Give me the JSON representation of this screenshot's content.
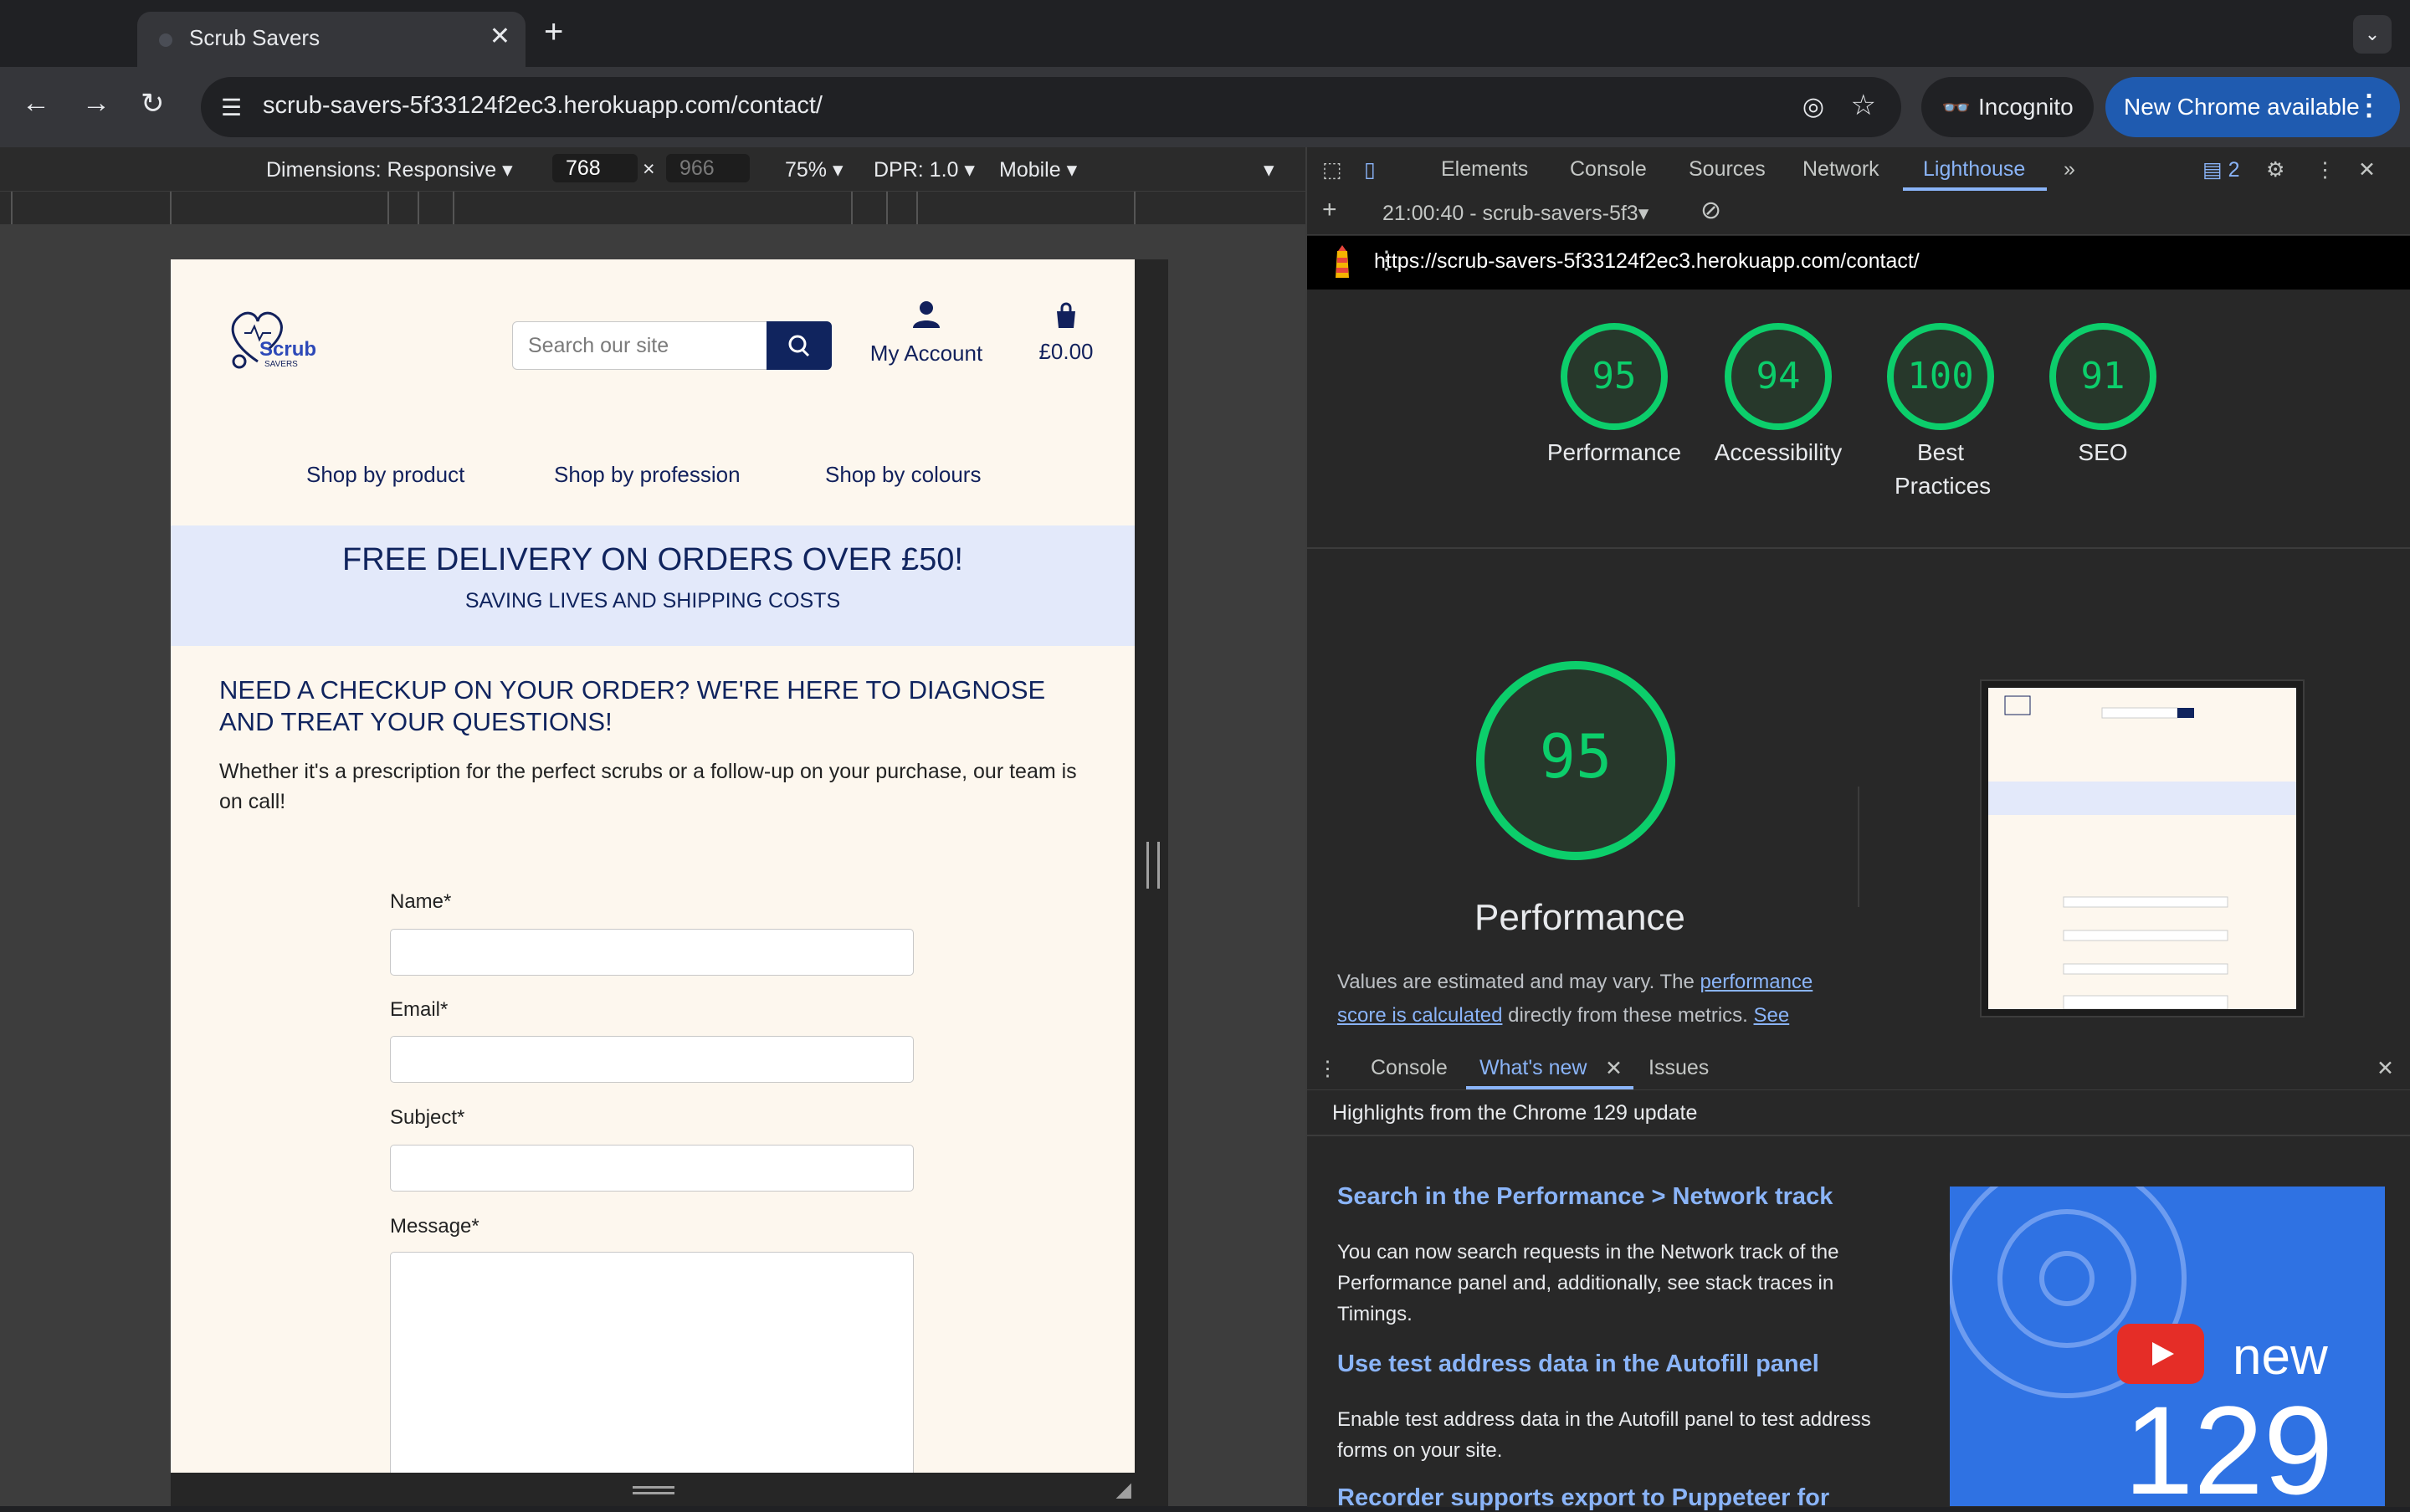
{
  "browser": {
    "tab_title": "Scrub Savers",
    "new_tab": "+",
    "url_host": "scrub-savers-5f33124f2ec3.herokuapp.com",
    "url_path": "/contact/",
    "incognito_label": "Incognito",
    "update_label": "New Chrome available"
  },
  "device_toolbar": {
    "dimensions": "Dimensions: Responsive",
    "width": "768",
    "times": "×",
    "height": "966",
    "zoom": "75%",
    "dpr": "DPR: 1.0",
    "throttle": "Mobile"
  },
  "site": {
    "logo_text": "Scrub",
    "logo_sub": "SAVERS",
    "search_placeholder": "Search our site",
    "account_label": "My Account",
    "basket_total": "£0.00",
    "nav": [
      "Shop by product",
      "Shop by profession",
      "Shop by colours"
    ],
    "banner_heading": "FREE DELIVERY ON ORDERS OVER £50!",
    "banner_sub": "SAVING LIVES AND SHIPPING COSTS",
    "heading": "NEED A CHECKUP ON YOUR ORDER? WE'RE HERE TO DIAGNOSE AND TREAT YOUR QUESTIONS!",
    "intro": "Whether it's a prescription for the perfect scrubs or a follow-up on your purchase, our team is on call!",
    "form": {
      "name_label": "Name*",
      "email_label": "Email*",
      "subject_label": "Subject*",
      "message_label": "Message*"
    }
  },
  "devtools": {
    "tabs": [
      "Elements",
      "Console",
      "Sources",
      "Network",
      "Lighthouse"
    ],
    "active_tab": "Lighthouse",
    "issues_count": "2",
    "report_select": "21:00:40 - scrub-savers-5f3",
    "report_url": "https://scrub-savers-5f33124f2ec3.herokuapp.com/contact/",
    "scores": [
      {
        "label": "Performance",
        "value": 95
      },
      {
        "label": "Accessibility",
        "value": 94
      },
      {
        "label": "Best Practices",
        "value": 100
      },
      {
        "label": "SEO",
        "value": 91
      }
    ],
    "big_score": "95",
    "big_label": "Performance",
    "note_prefix": "Values are estimated and may vary. The ",
    "note_link": "performance score is calculated",
    "note_middle": " directly from these metrics. ",
    "note_link2": "See",
    "colors": {
      "good": "#0cce6b",
      "good_fill": "#27382b"
    }
  },
  "drawer": {
    "tabs": [
      "Console",
      "What's new",
      "Issues"
    ],
    "active": "What's new",
    "highlights": "Highlights from the Chrome 129 update",
    "features": [
      {
        "title": "Search in the Performance > Network track",
        "desc": "You can now search requests in the Network track of the Performance panel and, additionally, see stack traces in Timings."
      },
      {
        "title": "Use test address data in the Autofill panel",
        "desc": "Enable test address data in the Autofill panel to test address forms on your site."
      },
      {
        "title": "Recorder supports export to Puppeteer for",
        "desc": ""
      }
    ],
    "video_new": "new",
    "video_version": "129"
  }
}
